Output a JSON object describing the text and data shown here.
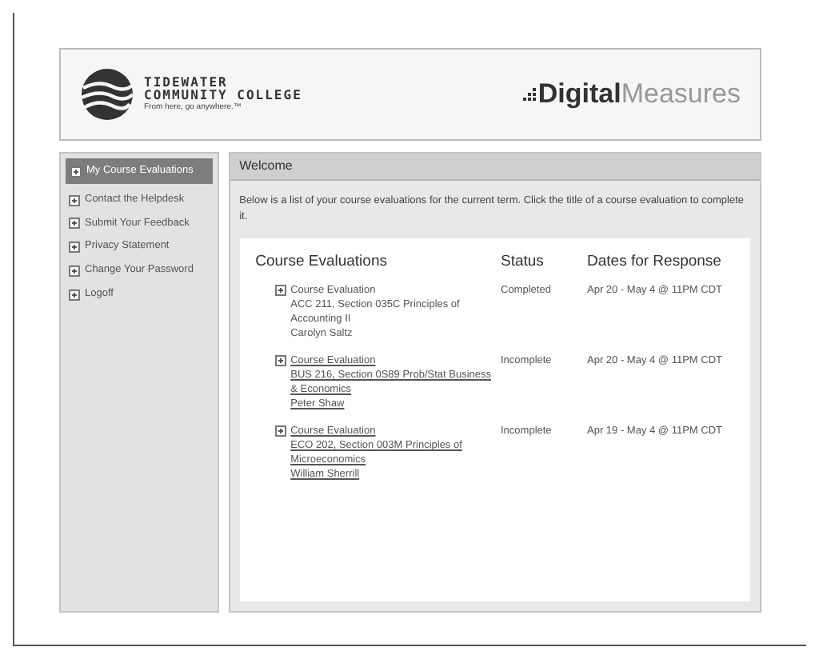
{
  "header": {
    "college_name_line1": "TIDEWATER",
    "college_name_line2": "COMMUNITY COLLEGE",
    "tagline": "From here, go anywhere.™",
    "brand_bold": "Digital",
    "brand_light": "Measures"
  },
  "sidebar": {
    "items": [
      {
        "label": "My Course Evaluations",
        "selected": true
      },
      {
        "label": "Contact the Helpdesk",
        "selected": false
      },
      {
        "label": "Submit Your Feedback",
        "selected": false
      },
      {
        "label": "Privacy Statement",
        "selected": false
      },
      {
        "label": "Change Your Password",
        "selected": false
      },
      {
        "label": "Logoff",
        "selected": false
      }
    ]
  },
  "main": {
    "title": "Welcome",
    "intro": "Below is a list of your course evaluations for the current term. Click the title of a course evaluation to complete it.",
    "columns": [
      "Course Evaluations",
      "Status",
      "Dates for Response"
    ],
    "rows": [
      {
        "lines": [
          "Course Evaluation",
          "ACC 211, Section 035C Principles of",
          "Accounting II",
          "Carolyn Saltz"
        ],
        "linked": false,
        "status": "Completed",
        "dates": "Apr 20 - May 4 @ 11PM CDT"
      },
      {
        "lines": [
          "Course Evaluation",
          "BUS 216, Section 0S89 Prob/Stat Business",
          "& Economics",
          "Peter Shaw"
        ],
        "linked": true,
        "status": "Incomplete",
        "dates": "Apr 20 - May 4 @ 11PM CDT"
      },
      {
        "lines": [
          "Course Evaluation",
          "ECO 202, Section 003M Principles of",
          "Microeconomics",
          "William Sherrill"
        ],
        "linked": true,
        "status": "Incomplete",
        "dates": "Apr 19 - May 4 @ 11PM CDT"
      }
    ]
  }
}
